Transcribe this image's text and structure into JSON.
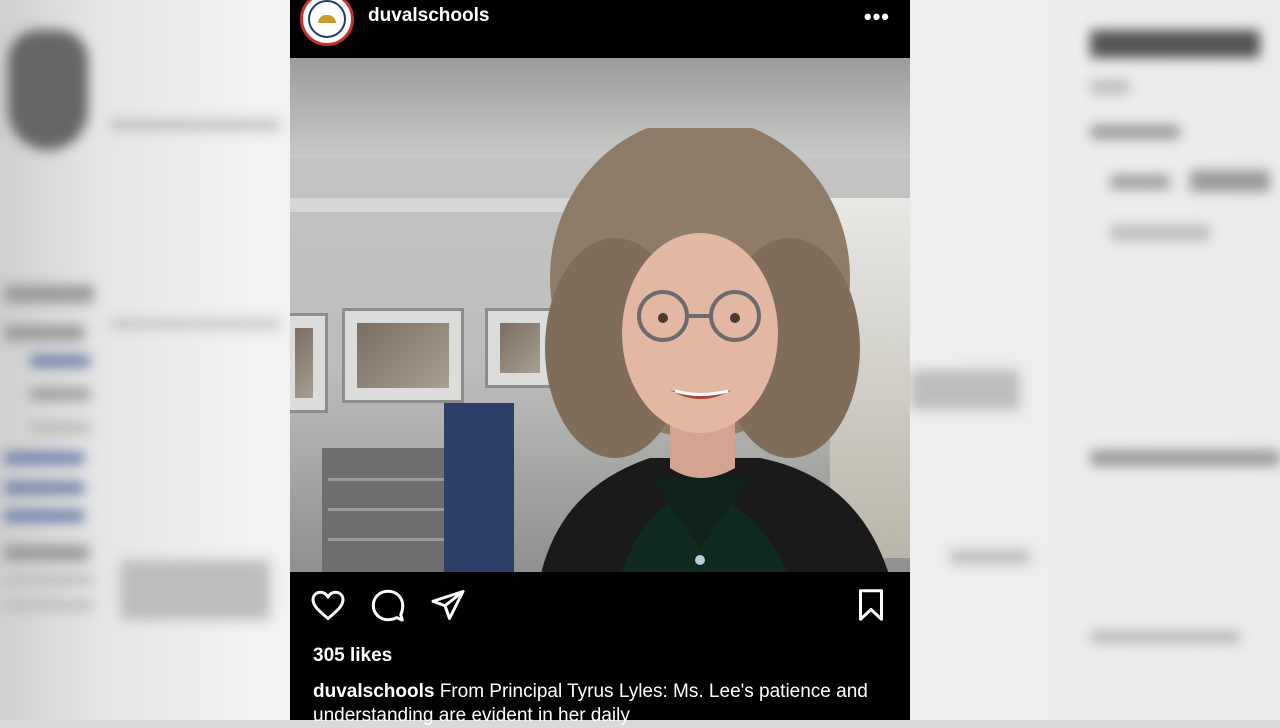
{
  "post": {
    "username": "duvalschools",
    "more_label": "•••",
    "likes": "305 likes",
    "caption_username": "duvalschools",
    "caption_text": "From Principal Tyrus Lyles: Ms. Lee's patience and understanding are evident in her daily"
  },
  "icons": {
    "like": "heart-icon",
    "comment": "comment-bubble-icon",
    "share": "send-paper-plane-icon",
    "save": "bookmark-icon",
    "more": "more-dots-icon"
  },
  "colors": {
    "post_background": "#000000",
    "text": "#ffffff",
    "avatar_ring": "#c8312e"
  }
}
